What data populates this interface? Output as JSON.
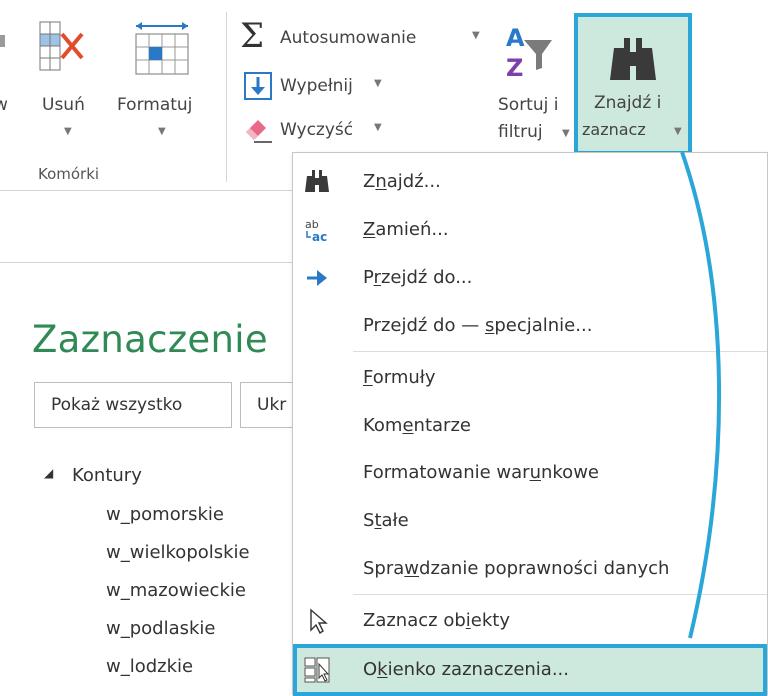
{
  "ribbon": {
    "cut_left_char": "w",
    "delete_label": "Usuń",
    "format_label": "Formatuj",
    "cells_group_label": "Komórki",
    "autosum_label": "Autosumowanie",
    "fill_label": "Wypełnij",
    "clear_label": "Wyczyść",
    "sort_label_line1": "Sortuj i",
    "sort_label_line2": "filtruj",
    "find_label_line1": "Znajdź i",
    "find_label_line2": "zaznacz",
    "colors": {
      "highlight": "#cde8dc",
      "callout_border": "#2aa6d8"
    }
  },
  "pane": {
    "title": "Zaznaczenie",
    "show_all_label": "Pokaż wszystko",
    "hide_all_label_partial": "Ukr",
    "tree_root": "Kontury",
    "tree_items": [
      "w_pomorskie",
      "w_wielkopolskie",
      "w_mazowieckie",
      "w_podlaskie",
      "w_lodzkie"
    ]
  },
  "menu": {
    "items": [
      {
        "pre": "Z",
        "acc": "n",
        "post": "ajdź...",
        "icon": "binoculars-icon"
      },
      {
        "pre": "",
        "acc": "Z",
        "post": "amień...",
        "icon": "replace-icon"
      },
      {
        "pre": "P",
        "acc": "r",
        "post": "zejdź do...",
        "icon": "arrow-right-icon"
      },
      {
        "pre": "Przejdź do — ",
        "acc": "s",
        "post": "pecjalnie...",
        "icon": ""
      },
      {
        "pre": "",
        "acc": "F",
        "post": "ormuły",
        "icon": ""
      },
      {
        "pre": "Kom",
        "acc": "e",
        "post": "ntarze",
        "icon": ""
      },
      {
        "pre": "Formatowanie war",
        "acc": "u",
        "post": "nkowe",
        "icon": ""
      },
      {
        "pre": "S",
        "acc": "t",
        "post": "ałe",
        "icon": ""
      },
      {
        "pre": "Spra",
        "acc": "w",
        "post": "dzanie poprawności danych",
        "icon": ""
      },
      {
        "pre": "Zaznacz ob",
        "acc": "i",
        "post": "ekty",
        "icon": "cursor-icon"
      },
      {
        "pre": "O",
        "acc": "k",
        "post": "ienko zaznaczenia...",
        "icon": "selection-pane-icon"
      }
    ]
  }
}
